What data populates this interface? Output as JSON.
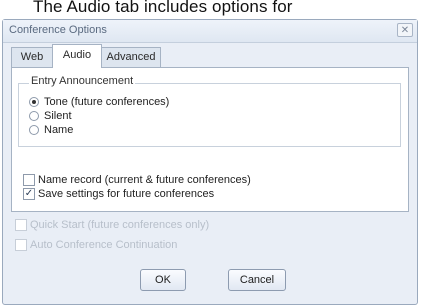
{
  "caption": "The Audio tab includes options for",
  "dialog": {
    "title": "Conference Options",
    "close_glyph": "✕"
  },
  "tabs": [
    {
      "label": "Web",
      "selected": false
    },
    {
      "label": "Audio",
      "selected": true
    },
    {
      "label": "Advanced",
      "selected": false
    }
  ],
  "entry_announcement": {
    "label": "Entry Announcement",
    "options": [
      {
        "label": "Tone (future conferences)",
        "selected": true
      },
      {
        "label": "Silent",
        "selected": false
      },
      {
        "label": "Name",
        "selected": false
      }
    ]
  },
  "checkboxes": [
    {
      "label": "Name record (current & future conferences)",
      "checked": false,
      "enabled": true
    },
    {
      "label": "Save settings for future conferences",
      "checked": true,
      "enabled": true
    }
  ],
  "outer_checkboxes": [
    {
      "label": "Quick Start (future conferences only)",
      "checked": false,
      "enabled": false
    },
    {
      "label": "Auto Conference Continuation",
      "checked": false,
      "enabled": false
    }
  ],
  "check_glyph": "✓",
  "buttons": {
    "ok": "OK",
    "cancel": "Cancel"
  }
}
